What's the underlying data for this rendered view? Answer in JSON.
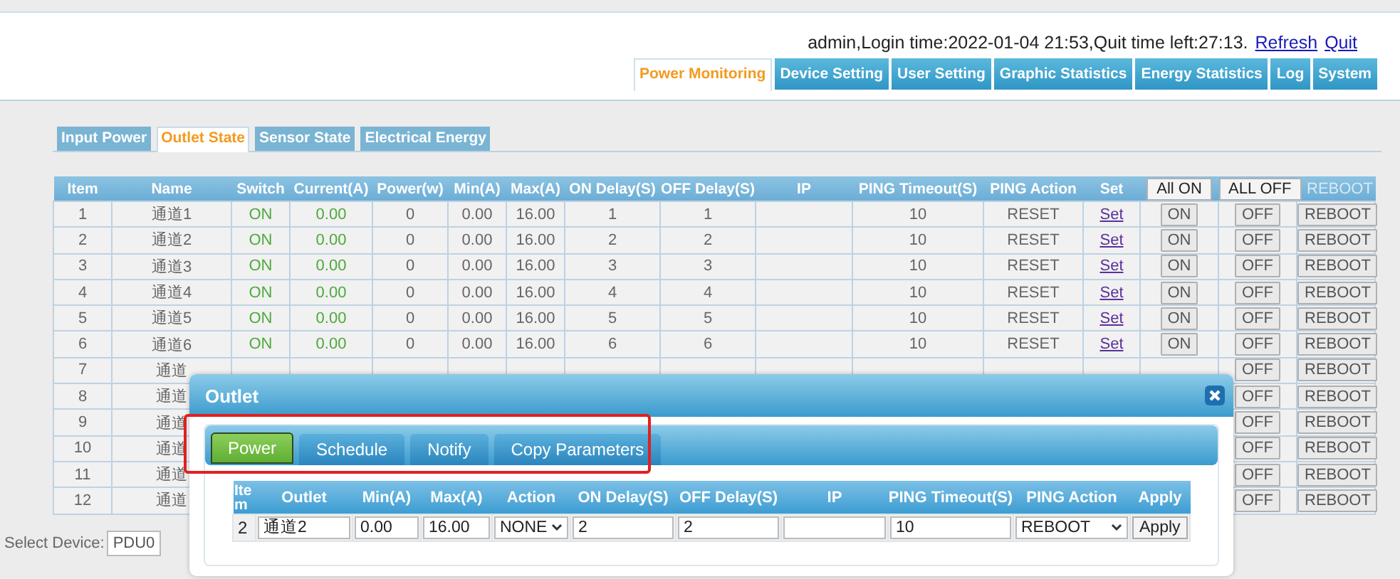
{
  "header": {
    "user_info": "admin,Login time:2022-01-04 21:53,Quit time left:27:13.",
    "links": [
      {
        "label": "Refresh"
      },
      {
        "label": "Quit"
      }
    ]
  },
  "nav_tabs": [
    {
      "label": "Power Monitoring",
      "selected": true
    },
    {
      "label": "Device Setting",
      "selected": false
    },
    {
      "label": "User Setting",
      "selected": false
    },
    {
      "label": "Graphic Statistics",
      "selected": false
    },
    {
      "label": "Energy Statistics",
      "selected": false
    },
    {
      "label": "Log",
      "selected": false
    },
    {
      "label": "System",
      "selected": false
    }
  ],
  "sub_tabs": [
    {
      "label": "Input Power",
      "selected": false
    },
    {
      "label": "Outlet State",
      "selected": true
    },
    {
      "label": "Sensor State",
      "selected": false
    },
    {
      "label": "Electrical Energy",
      "selected": false
    }
  ],
  "outlet_table": {
    "columns": [
      {
        "label": "Item",
        "kind": "heading"
      },
      {
        "label": "Name",
        "kind": "heading"
      },
      {
        "label": "Switch",
        "kind": "heading"
      },
      {
        "label": "Current(A)",
        "kind": "heading"
      },
      {
        "label": "Power(w)",
        "kind": "heading"
      },
      {
        "label": "Min(A)",
        "kind": "heading"
      },
      {
        "label": "Max(A)",
        "kind": "heading"
      },
      {
        "label": "ON Delay(S)",
        "kind": "heading"
      },
      {
        "label": "OFF Delay(S)",
        "kind": "heading"
      },
      {
        "label": "IP",
        "kind": "heading"
      },
      {
        "label": "PING Timeout(S)",
        "kind": "heading"
      },
      {
        "label": "PING Action",
        "kind": "heading"
      },
      {
        "label": "Set",
        "kind": "heading"
      },
      {
        "label": "All ON",
        "kind": "button",
        "disabled": false
      },
      {
        "label": "ALL OFF",
        "kind": "button",
        "disabled": false
      },
      {
        "label": "REBOOT",
        "kind": "button",
        "disabled": true
      }
    ],
    "rows": [
      {
        "item": "1",
        "name": "通道1",
        "switch": "ON",
        "current": "0.00",
        "power": "0",
        "min": "0.00",
        "max": "16.00",
        "on_delay": "1",
        "off_delay": "1",
        "ping_timeout": "10",
        "ping_action": "RESET",
        "set": "Set",
        "on": "ON",
        "off": "OFF",
        "reboot": "REBOOT"
      },
      {
        "item": "2",
        "name": "通道2",
        "switch": "ON",
        "current": "0.00",
        "power": "0",
        "min": "0.00",
        "max": "16.00",
        "on_delay": "2",
        "off_delay": "2",
        "ping_timeout": "10",
        "ping_action": "RESET",
        "set": "Set",
        "on": "ON",
        "off": "OFF",
        "reboot": "REBOOT"
      },
      {
        "item": "3",
        "name": "通道3",
        "switch": "ON",
        "current": "0.00",
        "power": "0",
        "min": "0.00",
        "max": "16.00",
        "on_delay": "3",
        "off_delay": "3",
        "ping_timeout": "10",
        "ping_action": "RESET",
        "set": "Set",
        "on": "ON",
        "off": "OFF",
        "reboot": "REBOOT"
      },
      {
        "item": "4",
        "name": "通道4",
        "switch": "ON",
        "current": "0.00",
        "power": "0",
        "min": "0.00",
        "max": "16.00",
        "on_delay": "4",
        "off_delay": "4",
        "ping_timeout": "10",
        "ping_action": "RESET",
        "set": "Set",
        "on": "ON",
        "off": "OFF",
        "reboot": "REBOOT"
      },
      {
        "item": "5",
        "name": "通道5",
        "switch": "ON",
        "current": "0.00",
        "power": "0",
        "min": "0.00",
        "max": "16.00",
        "on_delay": "5",
        "off_delay": "5",
        "ping_timeout": "10",
        "ping_action": "RESET",
        "set": "Set",
        "on": "ON",
        "off": "OFF",
        "reboot": "REBOOT"
      },
      {
        "item": "6",
        "name": "通道6",
        "switch": "ON",
        "current": "0.00",
        "power": "0",
        "min": "0.00",
        "max": "16.00",
        "on_delay": "6",
        "off_delay": "6",
        "ping_timeout": "10",
        "ping_action": "RESET",
        "set": "Set",
        "on": "ON",
        "off": "OFF",
        "reboot": "REBOOT"
      },
      {
        "item": "7",
        "name": "通道",
        "off": "OFF",
        "reboot": "REBOOT"
      },
      {
        "item": "8",
        "name": "通道",
        "off": "OFF",
        "reboot": "REBOOT"
      },
      {
        "item": "9",
        "name": "通道",
        "off": "OFF",
        "reboot": "REBOOT"
      },
      {
        "item": "10",
        "name": "通道",
        "off": "OFF",
        "reboot": "REBOOT"
      },
      {
        "item": "11",
        "name": "通道",
        "off": "OFF",
        "reboot": "REBOOT"
      },
      {
        "item": "12",
        "name": "通道",
        "off": "OFF",
        "reboot": "REBOOT"
      }
    ]
  },
  "device_select": {
    "label": "Select Device:",
    "value": "PDU0"
  },
  "dialog": {
    "title": "Outlet",
    "tabs": [
      {
        "label": "Power",
        "selected": true
      },
      {
        "label": "Schedule",
        "selected": false
      },
      {
        "label": "Notify",
        "selected": false
      },
      {
        "label": "Copy Parameters",
        "selected": false
      }
    ],
    "form": {
      "columns": [
        "Item",
        "Outlet",
        "Min(A)",
        "Max(A)",
        "Action",
        "ON Delay(S)",
        "OFF Delay(S)",
        "IP",
        "PING Timeout(S)",
        "PING Action",
        "Apply"
      ],
      "fields": [
        {
          "kind": "text",
          "value": "2"
        },
        {
          "kind": "input",
          "value": "通道2"
        },
        {
          "kind": "input",
          "value": "0.00"
        },
        {
          "kind": "input",
          "value": "16.00"
        },
        {
          "kind": "select",
          "value": "NONE"
        },
        {
          "kind": "input",
          "value": "2"
        },
        {
          "kind": "input",
          "value": "2"
        },
        {
          "kind": "input"
        },
        {
          "kind": "input",
          "value": "10"
        },
        {
          "kind": "select",
          "value": "REBOOT"
        },
        {
          "kind": "button",
          "label": "Apply"
        }
      ]
    }
  }
}
